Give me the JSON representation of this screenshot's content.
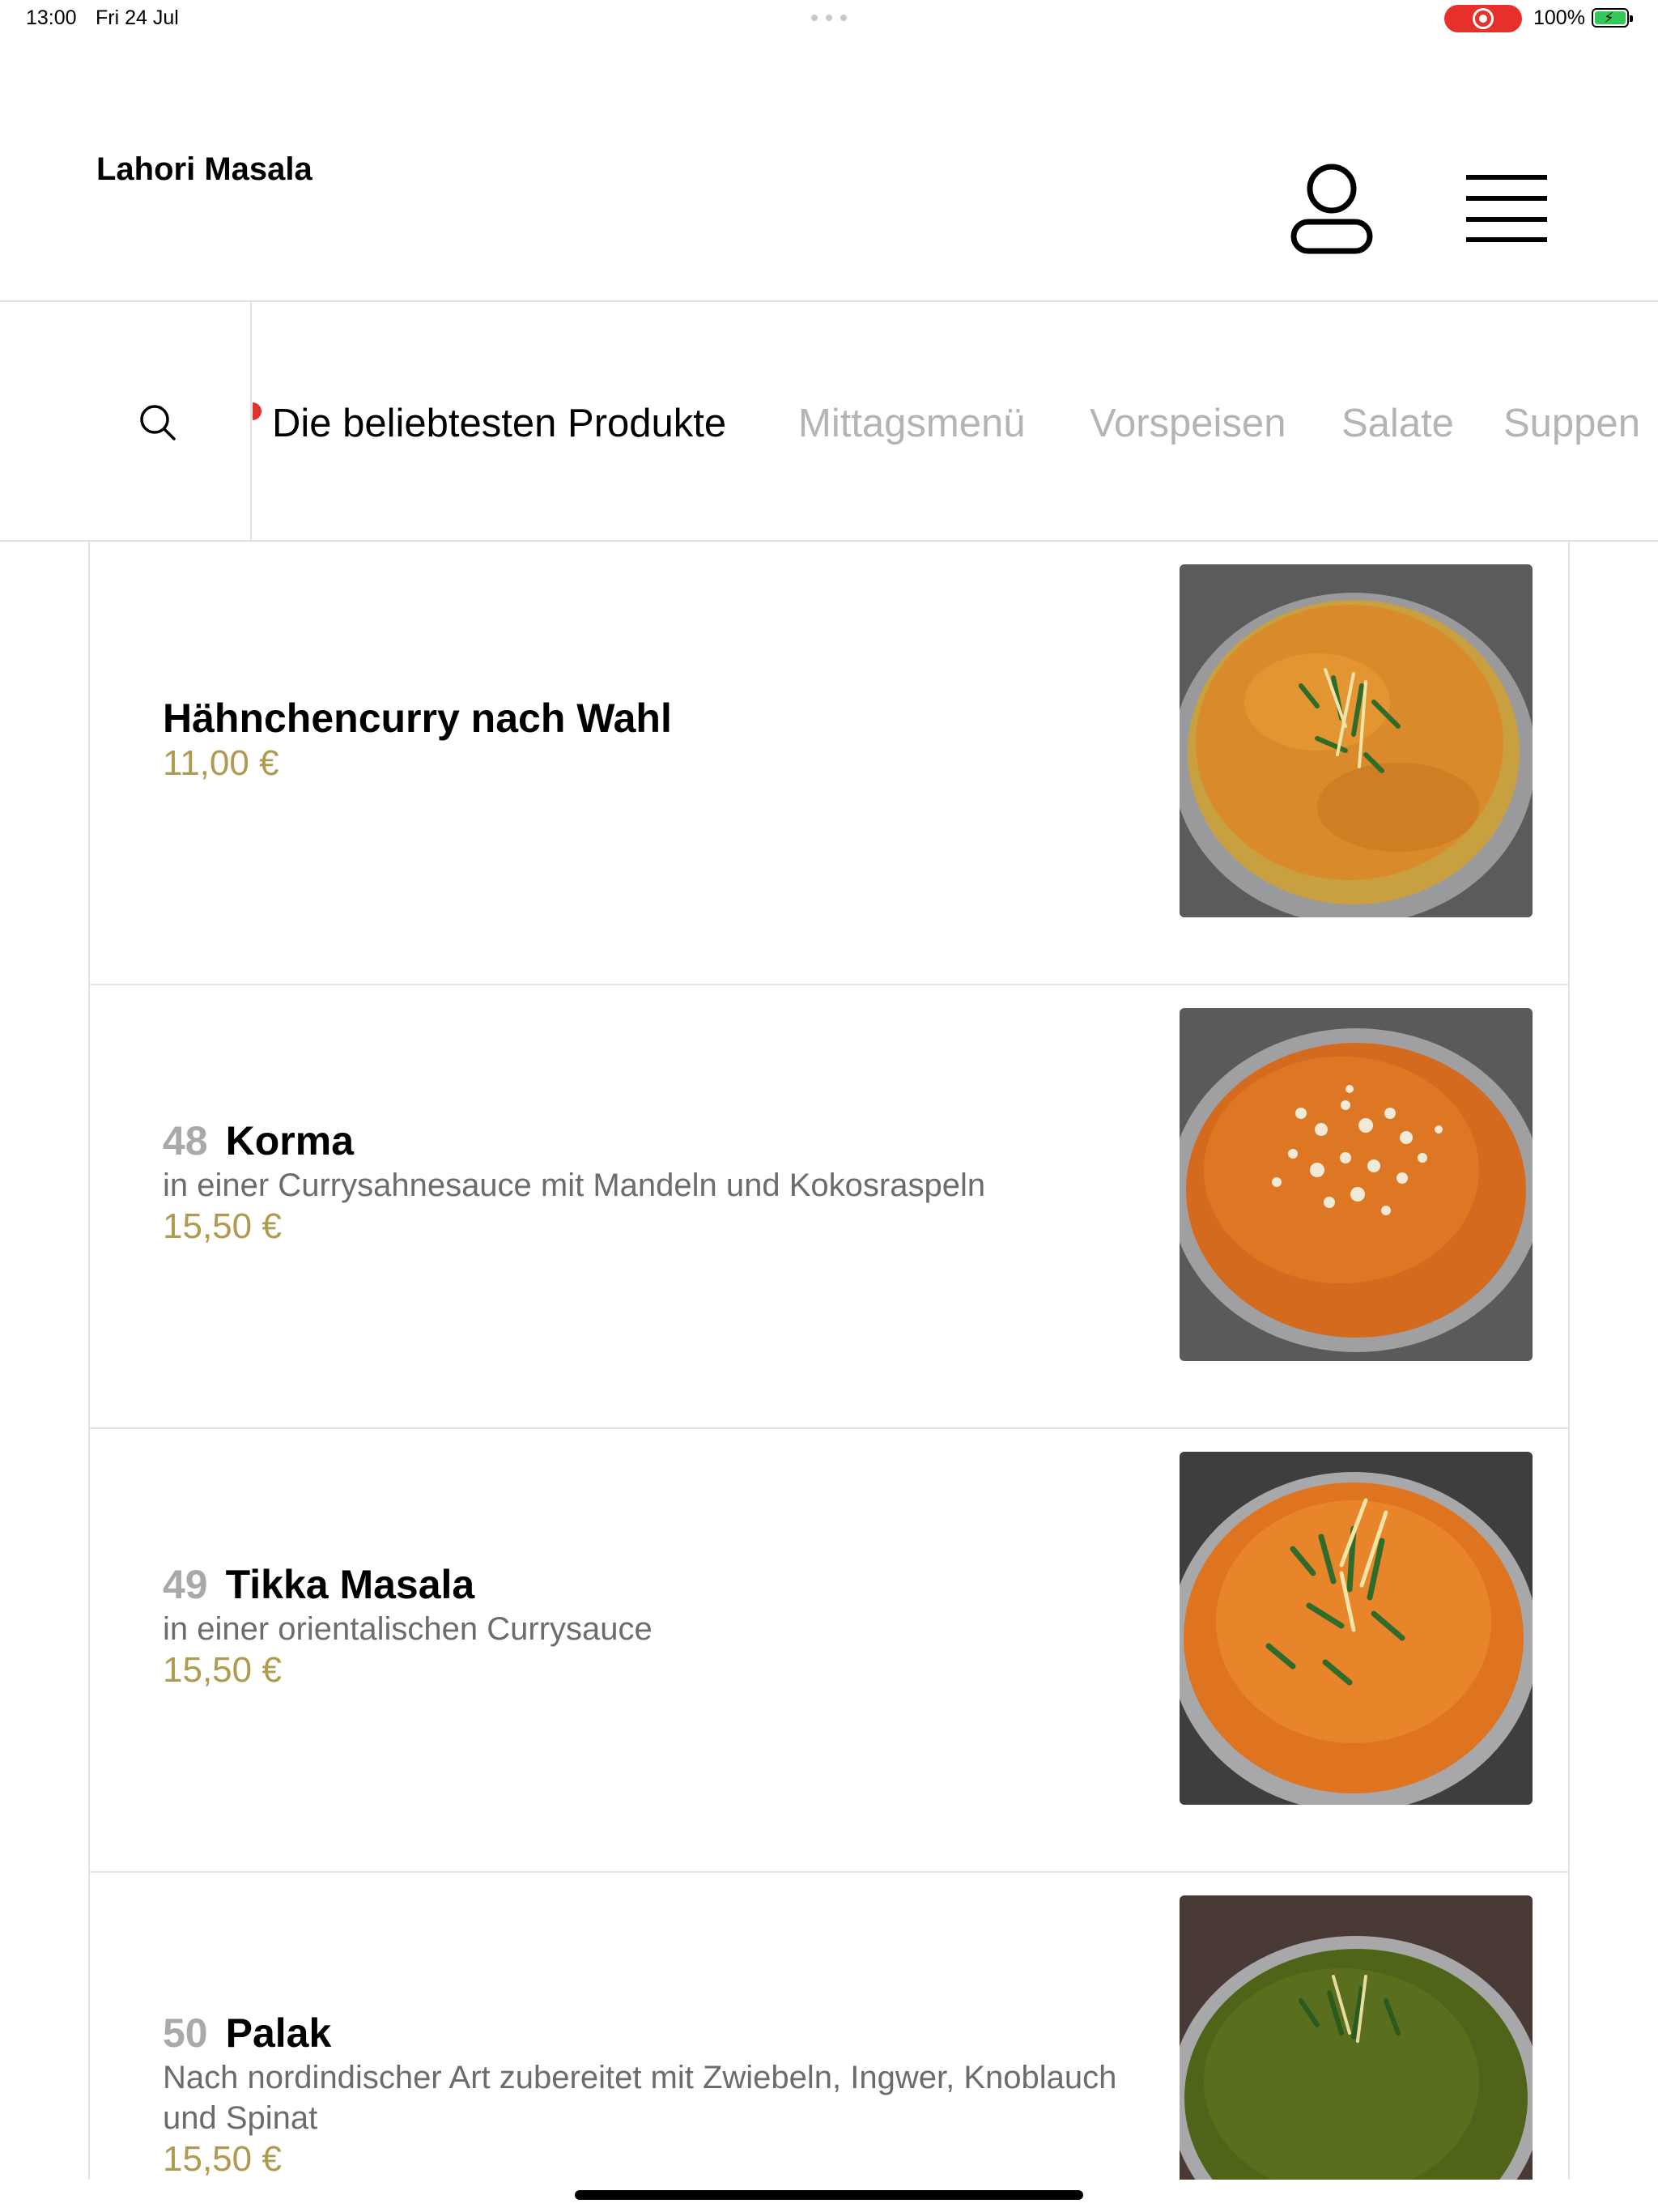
{
  "status_bar": {
    "time": "13:00",
    "date": "Fri 24 Jul",
    "battery": "100%",
    "colors": {
      "recording": "#e8302b",
      "battery_fill": "#34c759"
    }
  },
  "header": {
    "title": "Lahori Masala",
    "icons": {
      "account": "person-icon",
      "menu": "hamburger-menu-icon"
    }
  },
  "category_nav": {
    "search_icon": "search-icon",
    "tabs": [
      {
        "label": "Die beliebtesten Produkte",
        "active": true
      },
      {
        "label": "Mittagsmenü",
        "active": false
      },
      {
        "label": "Vorspeisen",
        "active": false
      },
      {
        "label": "Salate",
        "active": false
      },
      {
        "label": "Suppen",
        "active": false
      }
    ]
  },
  "products": [
    {
      "number": "",
      "name": "Hähnchencurry nach Wahl",
      "description": "",
      "price": "11,00 €",
      "photo": "curry-photo"
    },
    {
      "number": "48",
      "name": "Korma",
      "description": "in einer Currysahnesauce mit Mandeln und Kokosraspeln",
      "price": "15,50 €",
      "photo": "korma-photo"
    },
    {
      "number": "49",
      "name": "Tikka Masala",
      "description": "in einer orientalischen Currysauce",
      "price": "15,50 €",
      "photo": "tikka-masala-photo"
    },
    {
      "number": "50",
      "name": "Palak",
      "description": "Nach nordindischer Art zubereitet mit Zwiebeln, Ingwer, Knoblauch und Spinat",
      "price": "15,50 €",
      "photo": "palak-photo"
    }
  ],
  "colors": {
    "price": "#b09a4f",
    "active_tab": "#000000",
    "inactive_tab": "#b4b4b4",
    "tab_marker": "#e0322f"
  }
}
